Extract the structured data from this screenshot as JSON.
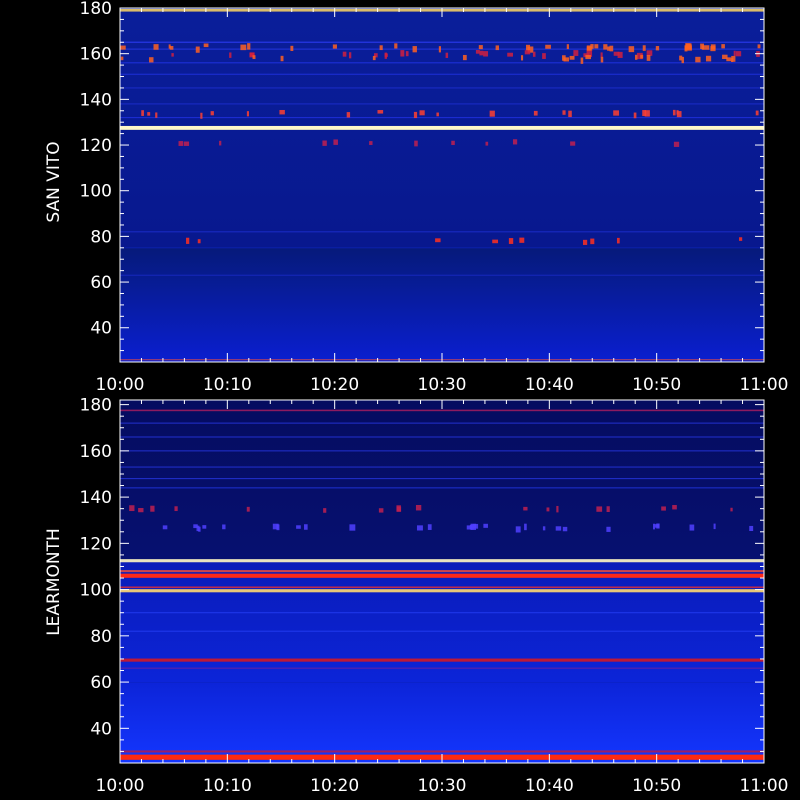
{
  "chart_data": [
    {
      "type": "heatmap",
      "ylabel": "SAN VITO",
      "x_ticks": [
        "10:00",
        "10:10",
        "10:20",
        "10:30",
        "10:40",
        "10:50",
        "11:00"
      ],
      "x_range": [
        "10:00",
        "11:00"
      ],
      "y_ticks": [
        40,
        60,
        80,
        100,
        120,
        140,
        160,
        180
      ],
      "ylim": [
        25,
        180
      ],
      "background_bands": [
        {
          "from": 25,
          "to": 75,
          "low": "#0a1fd0",
          "high": "#061a7a"
        },
        {
          "from": 75,
          "to": 180,
          "low": "#08188e",
          "high": "#0a1e9a"
        }
      ],
      "lines": [
        {
          "y": 179,
          "color": "#ffd860",
          "weight": 1.0
        },
        {
          "y": 127.5,
          "color": "#fff8c8",
          "weight": 1.5
        },
        {
          "y": 165,
          "color": "#3040ff",
          "weight": 0.5
        },
        {
          "y": 162,
          "color": "#3040ff",
          "weight": 0.4
        },
        {
          "y": 156,
          "color": "#2a3cff",
          "weight": 0.4
        },
        {
          "y": 151,
          "color": "#2a3cff",
          "weight": 0.3
        },
        {
          "y": 145,
          "color": "#2536e8",
          "weight": 0.3
        },
        {
          "y": 138,
          "color": "#2536e8",
          "weight": 0.3
        },
        {
          "y": 132,
          "color": "#2a3cff",
          "weight": 0.3
        },
        {
          "y": 82,
          "color": "#2536e8",
          "weight": 0.3
        },
        {
          "y": 75,
          "color": "#1028c8",
          "weight": 0.3
        },
        {
          "y": 63,
          "color": "#2030d8",
          "weight": 0.3
        },
        {
          "y": 26,
          "color": "#ff5030",
          "weight": 0.4
        }
      ],
      "bursts": [
        {
          "y": 163,
          "color": "#ff6020",
          "density": 0.35
        },
        {
          "y": 160,
          "color": "#d02040",
          "density": 0.25
        },
        {
          "y": 158,
          "color": "#ff6020",
          "density": 0.2
        },
        {
          "y": 134,
          "color": "#ff4030",
          "density": 0.2
        },
        {
          "y": 121,
          "color": "#c02050",
          "density": 0.1
        },
        {
          "y": 78,
          "color": "#ff3020",
          "density": 0.08
        }
      ]
    },
    {
      "type": "heatmap",
      "ylabel": "LEARMONTH",
      "x_ticks": [
        "10:00",
        "10:10",
        "10:20",
        "10:30",
        "10:40",
        "10:50",
        "11:00"
      ],
      "x_range": [
        "10:00",
        "11:00"
      ],
      "y_ticks": [
        40,
        60,
        80,
        100,
        120,
        140,
        160,
        180
      ],
      "ylim": [
        25,
        182
      ],
      "background_bands": [
        {
          "from": 25,
          "to": 60,
          "low": "#1436ff",
          "high": "#0c24d8"
        },
        {
          "from": 60,
          "to": 113,
          "low": "#0c24d8",
          "high": "#0a1cb8"
        },
        {
          "from": 113,
          "to": 182,
          "low": "#061070",
          "high": "#050c60"
        }
      ],
      "lines": [
        {
          "y": 27.5,
          "color": "#ff2a10",
          "weight": 2.0
        },
        {
          "y": 30,
          "color": "#c01a40",
          "weight": 0.8
        },
        {
          "y": 69.5,
          "color": "#d01828",
          "weight": 1.2
        },
        {
          "y": 66,
          "color": "#7020a0",
          "weight": 0.5
        },
        {
          "y": 99.5,
          "color": "#ffd870",
          "weight": 1.2
        },
        {
          "y": 101,
          "color": "#ff3020",
          "weight": 0.6
        },
        {
          "y": 106,
          "color": "#ff2818",
          "weight": 1.6
        },
        {
          "y": 108,
          "color": "#ff5030",
          "weight": 0.8
        },
        {
          "y": 112.5,
          "color": "#fff6c0",
          "weight": 1.2
        },
        {
          "y": 90,
          "color": "#2a44ff",
          "weight": 0.4
        },
        {
          "y": 82,
          "color": "#2a44ff",
          "weight": 0.4
        },
        {
          "y": 144,
          "color": "#2a40ff",
          "weight": 0.4
        },
        {
          "y": 148,
          "color": "#3040ff",
          "weight": 0.4
        },
        {
          "y": 153,
          "color": "#3040ff",
          "weight": 0.4
        },
        {
          "y": 160,
          "color": "#3040ff",
          "weight": 0.4
        },
        {
          "y": 166,
          "color": "#3040ff",
          "weight": 0.4
        },
        {
          "y": 172,
          "color": "#3040ff",
          "weight": 0.4
        },
        {
          "y": 177.5,
          "color": "#c02060",
          "weight": 0.6
        }
      ],
      "bursts": [
        {
          "y": 135,
          "color": "#c02050",
          "density": 0.15
        },
        {
          "y": 127,
          "color": "#5040ff",
          "density": 0.25
        }
      ]
    }
  ]
}
